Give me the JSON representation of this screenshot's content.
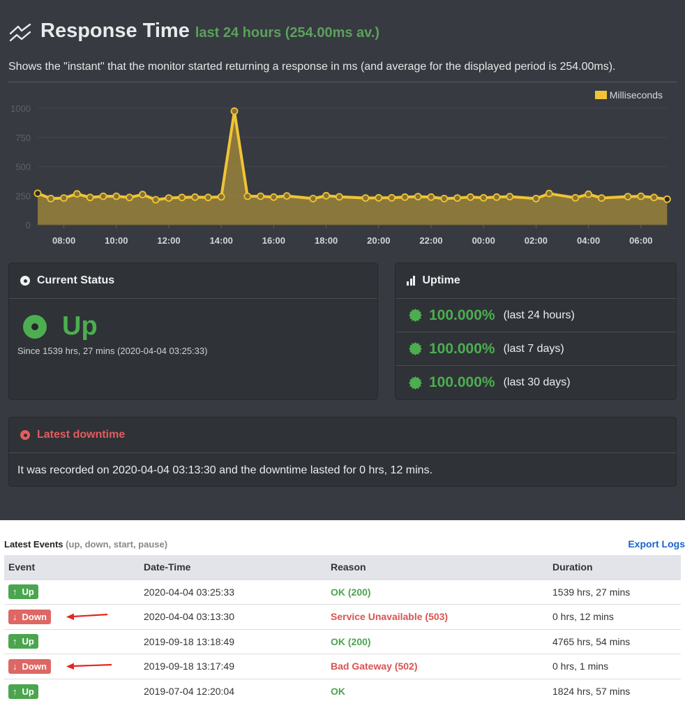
{
  "header": {
    "title": "Response Time",
    "subtitle": "last 24 hours (254.00ms av.)",
    "description": "Shows the \"instant\" that the monitor started returning a response in ms (and average for the displayed period is 254.00ms).",
    "icon": "line-chart-icon"
  },
  "chart_data": {
    "type": "area",
    "title": "Response Time",
    "xlabel": "",
    "ylabel": "",
    "legend": {
      "entries": [
        "Milliseconds"
      ],
      "placement": "top-right"
    },
    "ylim": [
      0,
      1000
    ],
    "yticks": [
      0,
      250,
      500,
      750,
      1000
    ],
    "xticks": [
      "08:00",
      "10:00",
      "12:00",
      "14:00",
      "16:00",
      "18:00",
      "20:00",
      "22:00",
      "00:00",
      "02:00",
      "04:00",
      "06:00"
    ],
    "grid": true,
    "color": "#f0c435",
    "series": [
      {
        "name": "Milliseconds",
        "points": [
          {
            "t": "07:00",
            "h": 7.0,
            "v": 270
          },
          {
            "t": "07:30",
            "h": 7.5,
            "v": 225
          },
          {
            "t": "08:00",
            "h": 8.0,
            "v": 230
          },
          {
            "t": "08:30",
            "h": 8.5,
            "v": 265
          },
          {
            "t": "09:00",
            "h": 9.0,
            "v": 235
          },
          {
            "t": "09:30",
            "h": 9.5,
            "v": 245
          },
          {
            "t": "10:00",
            "h": 10.0,
            "v": 245
          },
          {
            "t": "10:30",
            "h": 10.5,
            "v": 235
          },
          {
            "t": "11:00",
            "h": 11.0,
            "v": 260
          },
          {
            "t": "11:30",
            "h": 11.5,
            "v": 215
          },
          {
            "t": "12:00",
            "h": 12.0,
            "v": 230
          },
          {
            "t": "12:30",
            "h": 12.5,
            "v": 235
          },
          {
            "t": "13:00",
            "h": 13.0,
            "v": 238
          },
          {
            "t": "13:30",
            "h": 13.5,
            "v": 235
          },
          {
            "t": "14:00",
            "h": 14.0,
            "v": 240
          },
          {
            "t": "14:30",
            "h": 14.5,
            "v": 975
          },
          {
            "t": "15:00",
            "h": 15.0,
            "v": 245
          },
          {
            "t": "15:30",
            "h": 15.5,
            "v": 245
          },
          {
            "t": "16:00",
            "h": 16.0,
            "v": 238
          },
          {
            "t": "16:30",
            "h": 16.5,
            "v": 248
          },
          {
            "t": "17:30",
            "h": 17.5,
            "v": 225
          },
          {
            "t": "18:00",
            "h": 18.0,
            "v": 250
          },
          {
            "t": "18:30",
            "h": 18.5,
            "v": 240
          },
          {
            "t": "19:30",
            "h": 19.5,
            "v": 230
          },
          {
            "t": "20:00",
            "h": 20.0,
            "v": 232
          },
          {
            "t": "20:30",
            "h": 20.5,
            "v": 232
          },
          {
            "t": "21:00",
            "h": 21.0,
            "v": 238
          },
          {
            "t": "21:30",
            "h": 21.5,
            "v": 242
          },
          {
            "t": "22:00",
            "h": 22.0,
            "v": 238
          },
          {
            "t": "22:30",
            "h": 22.5,
            "v": 225
          },
          {
            "t": "23:00",
            "h": 23.0,
            "v": 230
          },
          {
            "t": "23:30",
            "h": 23.5,
            "v": 238
          },
          {
            "t": "00:00",
            "h": 24.0,
            "v": 232
          },
          {
            "t": "00:30",
            "h": 24.5,
            "v": 238
          },
          {
            "t": "01:00",
            "h": 25.0,
            "v": 242
          },
          {
            "t": "02:00",
            "h": 26.0,
            "v": 225
          },
          {
            "t": "02:30",
            "h": 26.5,
            "v": 268
          },
          {
            "t": "03:30",
            "h": 27.5,
            "v": 232
          },
          {
            "t": "04:00",
            "h": 28.0,
            "v": 262
          },
          {
            "t": "04:30",
            "h": 28.5,
            "v": 230
          },
          {
            "t": "05:30",
            "h": 29.5,
            "v": 242
          },
          {
            "t": "06:00",
            "h": 30.0,
            "v": 245
          },
          {
            "t": "06:30",
            "h": 30.5,
            "v": 235
          },
          {
            "t": "07:00",
            "h": 31.0,
            "v": 220
          }
        ]
      }
    ]
  },
  "current_status": {
    "heading": "Current Status",
    "status": "Up",
    "since": "Since 1539 hrs, 27 mins (2020-04-04 03:25:33)",
    "color": "#4cae50"
  },
  "uptime": {
    "heading": "Uptime",
    "rows": [
      {
        "percent": "100.000%",
        "range": "(last 24 hours)"
      },
      {
        "percent": "100.000%",
        "range": "(last 7 days)"
      },
      {
        "percent": "100.000%",
        "range": "(last 30 days)"
      }
    ]
  },
  "latest_downtime": {
    "heading": "Latest downtime",
    "text": "It was recorded on 2020-04-04 03:13:30 and the downtime lasted for 0 hrs, 12 mins.",
    "color": "#e35d5d"
  },
  "events": {
    "title": "Latest Events",
    "subtitle": "(up, down, start, pause)",
    "export_label": "Export Logs",
    "columns": [
      "Event",
      "Date-Time",
      "Reason",
      "Duration"
    ],
    "rows": [
      {
        "type": "up",
        "arrow": "↑",
        "label": "Up",
        "datetime": "2020-04-04 03:25:33",
        "reason": "OK (200)",
        "duration": "1539 hrs, 27 mins",
        "annotated": false
      },
      {
        "type": "down",
        "arrow": "↓",
        "label": "Down",
        "datetime": "2020-04-04 03:13:30",
        "reason": "Service Unavailable (503)",
        "duration": "0 hrs, 12 mins",
        "annotated": true
      },
      {
        "type": "up",
        "arrow": "↑",
        "label": "Up",
        "datetime": "2019-09-18 13:18:49",
        "reason": "OK (200)",
        "duration": "4765 hrs, 54 mins",
        "annotated": false
      },
      {
        "type": "down",
        "arrow": "↓",
        "label": "Down",
        "datetime": "2019-09-18 13:17:49",
        "reason": "Bad Gateway (502)",
        "duration": "0 hrs, 1 mins",
        "annotated": true
      },
      {
        "type": "up",
        "arrow": "↑",
        "label": "Up",
        "datetime": "2019-07-04 12:20:04",
        "reason": "OK",
        "duration": "1824 hrs, 57 mins",
        "annotated": false
      }
    ]
  }
}
